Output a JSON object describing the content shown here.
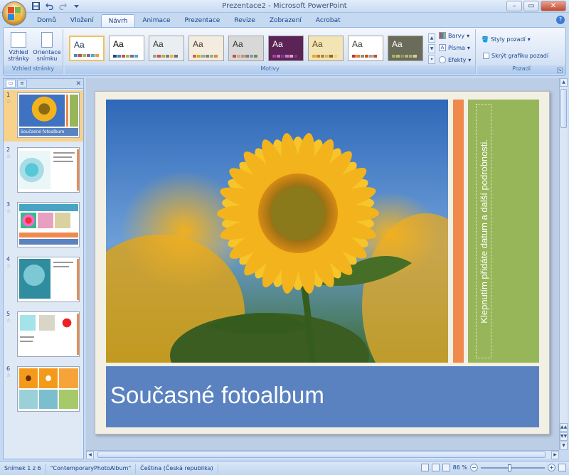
{
  "window": {
    "title": "Prezentace2 - Microsoft PowerPoint",
    "controls": [
      "–",
      "▭",
      "✕"
    ]
  },
  "quick_access": {
    "icons": [
      "save-icon",
      "undo-icon",
      "redo-icon",
      "customize-icon"
    ]
  },
  "tabs": [
    {
      "label": "Domů"
    },
    {
      "label": "Vložení"
    },
    {
      "label": "Návrh",
      "active": true
    },
    {
      "label": "Animace"
    },
    {
      "label": "Prezentace"
    },
    {
      "label": "Revize"
    },
    {
      "label": "Zobrazení"
    },
    {
      "label": "Acrobat"
    }
  ],
  "ribbon": {
    "page_setup": {
      "group_label": "Vzhled stránky",
      "page_setup_btn": "Vzhled stránky",
      "orientation_btn": "Orientace snímku"
    },
    "themes": {
      "group_label": "Motivy",
      "tile_text": "Aa",
      "tiles": [
        {
          "bg": "#ffffff",
          "fg": "#1f3a60",
          "sw": [
            "#4f81bd",
            "#c0504d",
            "#9bbb59",
            "#8064a2",
            "#4bacc6",
            "#f79646"
          ],
          "selected": true
        },
        {
          "bg": "#ffffff",
          "fg": "#000000",
          "sw": [
            "#1f497d",
            "#4f81bd",
            "#c0504d",
            "#9bbb59",
            "#8064a2",
            "#4bacc6"
          ]
        },
        {
          "bg": "#e8eef1",
          "fg": "#333333",
          "sw": [
            "#93a299",
            "#cf543f",
            "#b5ae53",
            "#848058",
            "#e8b54d",
            "#786c71"
          ]
        },
        {
          "bg": "#f5ece0",
          "fg": "#4c3c2c",
          "sw": [
            "#d16349",
            "#ccb400",
            "#8cadae",
            "#8c7b70",
            "#8fb08c",
            "#d19049"
          ]
        },
        {
          "bg": "#d8d8d8",
          "fg": "#333333",
          "sw": [
            "#c0504d",
            "#d6a38b",
            "#b0a06e",
            "#98766c",
            "#7e9ab5",
            "#6d8b56"
          ]
        },
        {
          "bg": "#5c2456",
          "fg": "#ffffff",
          "sw": [
            "#a9449a",
            "#d06ad0",
            "#7b3b8c",
            "#c084b9",
            "#e0a0d0",
            "#783c6c"
          ]
        },
        {
          "bg": "#f2e4b5",
          "fg": "#5b4a1e",
          "sw": [
            "#e3a92f",
            "#c77c25",
            "#a8872f",
            "#d7b65b",
            "#8c6a25",
            "#f0d27a"
          ]
        },
        {
          "bg": "#ffffff",
          "fg": "#3a3a3a",
          "sw": [
            "#c0392b",
            "#e67e22",
            "#7f8c8d",
            "#d35400",
            "#95a5a6",
            "#bd4e31"
          ]
        },
        {
          "bg": "#6b6b5a",
          "fg": "#ffffff",
          "sw": [
            "#9bbb59",
            "#c0c06a",
            "#8a9a5b",
            "#b5b58c",
            "#a8b46a",
            "#d1d19a"
          ]
        }
      ],
      "gallery_scroll": [
        "▲",
        "▼",
        "▾"
      ],
      "colors_btn": "Barvy",
      "fonts_btn": "Písma",
      "effects_btn": "Efekty",
      "fonts_icon_glyph": "A"
    },
    "background": {
      "group_label": "Pozadí",
      "styles_btn": "Styly pozadí",
      "hide_graphics_label": "Skrýt grafiku pozadí",
      "hide_graphics_checked": false
    }
  },
  "slides": [
    {
      "number": "1",
      "caption": "Současné fotoalbum",
      "selected": true
    },
    {
      "number": "2"
    },
    {
      "number": "3"
    },
    {
      "number": "4"
    },
    {
      "number": "5"
    },
    {
      "number": "6"
    }
  ],
  "slide": {
    "title": "Současné fotoalbum",
    "side_placeholder": "Klepnutím přidáte datum a další podrobnosti.",
    "colors": {
      "background": "#f2f0e4",
      "accent_orange": "#ef8a4c",
      "accent_green": "#97b65a",
      "title_band": "#5a82c0"
    }
  },
  "status": {
    "slide_counter": "Snímek 1 z 6",
    "theme_name": "\"ContemporaryPhotoAlbum\"",
    "language": "Čeština (Česká republika)",
    "zoom": "86 %",
    "zoom_fraction": 0.45
  }
}
